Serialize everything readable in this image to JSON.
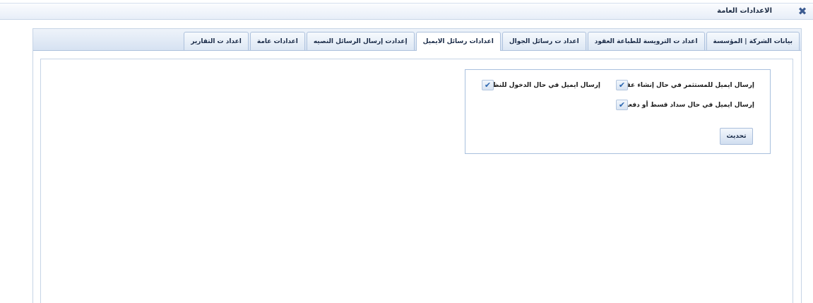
{
  "window": {
    "title": "الاعدادات العامة",
    "close_icon": "close-icon",
    "accent": "#3c5c91"
  },
  "tabs": [
    {
      "label": "بيانات الشركة | المؤسسة",
      "active": false
    },
    {
      "label": "اعداد ت الترويسة للطباعة العقود",
      "active": false
    },
    {
      "label": "اعداد ت رسائل الجوال",
      "active": false
    },
    {
      "label": "اعدادات رسائل الايميل",
      "active": true
    },
    {
      "label": "إعدادت إرسال الرسائل النصيه",
      "active": false
    },
    {
      "label": "اعدادات عامة",
      "active": false
    },
    {
      "label": "اعداد ت التقارير",
      "active": false
    }
  ],
  "email_settings": {
    "contract_label": "إرسال ايميل للمستثمر في حال إنشاء عقد :",
    "contract_checked": true,
    "login_label": "إرسال ايميل في حال الدخول للنظام:",
    "login_checked": true,
    "payment_label": "إرسال ايميل في حال سداد قسط أو دفعة:",
    "payment_checked": true,
    "update_button": "تحديث"
  }
}
